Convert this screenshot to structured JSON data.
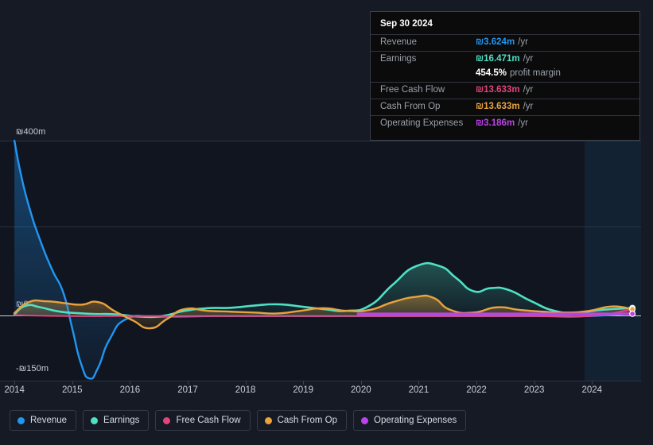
{
  "tooltip": {
    "date": "Sep 30 2024",
    "rows": [
      {
        "label": "Revenue",
        "value": "₪3.624m",
        "unit": "/yr",
        "color": "#2196f3"
      },
      {
        "label": "Earnings",
        "value": "₪16.471m",
        "unit": "/yr",
        "color": "#4fe0c4"
      },
      {
        "label": "Free Cash Flow",
        "value": "₪13.633m",
        "unit": "/yr",
        "color": "#e0457b"
      },
      {
        "label": "Cash From Op",
        "value": "₪13.633m",
        "unit": "/yr",
        "color": "#e8a33d"
      },
      {
        "label": "Operating Expenses",
        "value": "₪3.186m",
        "unit": "/yr",
        "color": "#bb44e8"
      }
    ],
    "profit_margin_value": "454.5%",
    "profit_margin_label": "profit margin"
  },
  "legend": {
    "items": [
      {
        "label": "Revenue",
        "color": "#2196f3"
      },
      {
        "label": "Earnings",
        "color": "#4fe0c4"
      },
      {
        "label": "Free Cash Flow",
        "color": "#e0457b"
      },
      {
        "label": "Cash From Op",
        "color": "#e8a33d"
      },
      {
        "label": "Operating Expenses",
        "color": "#bb44e8"
      }
    ]
  },
  "axis": {
    "y_top_label": "₪400m",
    "y_zero_label": "₪0",
    "y_bottom_label": "-₪150m",
    "x_labels": [
      "2014",
      "2015",
      "2016",
      "2017",
      "2018",
      "2019",
      "2020",
      "2021",
      "2022",
      "2023",
      "2024"
    ]
  },
  "chart_data": {
    "type": "area",
    "title": "",
    "xlabel": "",
    "ylabel": "₪",
    "ylim": [
      -150,
      400
    ],
    "y_ticks": [
      400,
      200,
      0,
      -150
    ],
    "y_tick_labels": [
      "₪400m",
      "",
      "₪0",
      "-₪150m"
    ],
    "grid": true,
    "legend_position": "bottom",
    "x_range": [
      2013.8,
      2024.9
    ],
    "x_tick_labels": [
      "2014",
      "2015",
      "2016",
      "2017",
      "2018",
      "2019",
      "2020",
      "2021",
      "2022",
      "2023",
      "2024"
    ],
    "forecast_start": 2023.9,
    "units": "ILS millions per year",
    "series": [
      {
        "name": "Revenue",
        "color": "#2196f3",
        "x": [
          2014.05,
          2014.15,
          2014.3,
          2014.5,
          2014.7,
          2014.9,
          2015.05,
          2015.2,
          2015.35,
          2015.5,
          2015.7,
          2016.0,
          2016.5,
          2017.0,
          2017.5,
          2018.0,
          2018.5,
          2019.0,
          2019.5,
          2020.0,
          2020.5,
          2021.0,
          2021.5,
          2022.0,
          2022.5,
          2023.0,
          2023.5,
          2024.0,
          2024.75
        ],
        "values": [
          400,
          330,
          250,
          170,
          105,
          50,
          -30,
          -110,
          -145,
          -120,
          -55,
          -8,
          -4,
          -3,
          -2,
          -2,
          -2,
          -2,
          -2,
          -2,
          -2,
          -2,
          -2,
          -2,
          -2,
          -2,
          -2,
          -2,
          3.624
        ]
      },
      {
        "name": "Earnings",
        "color": "#4fe0c4",
        "x": [
          2014.05,
          2014.25,
          2014.5,
          2014.8,
          2015.1,
          2015.4,
          2015.8,
          2016.2,
          2016.6,
          2017.0,
          2017.4,
          2017.8,
          2018.2,
          2018.6,
          2019.0,
          2019.4,
          2019.8,
          2020.2,
          2020.6,
          2021.0,
          2021.4,
          2021.7,
          2022.0,
          2022.3,
          2022.6,
          2023.0,
          2023.4,
          2023.8,
          2024.2,
          2024.75
        ],
        "values": [
          2,
          22,
          18,
          9,
          5,
          3,
          2,
          -3,
          -2,
          10,
          16,
          17,
          22,
          25,
          20,
          14,
          10,
          22,
          70,
          112,
          113,
          85,
          55,
          62,
          58,
          32,
          10,
          6,
          12,
          16.471
        ]
      },
      {
        "name": "Free Cash Flow",
        "color": "#e0457b",
        "x": [
          2014.05,
          2015.0,
          2016.0,
          2017.0,
          2018.0,
          2019.0,
          2020.0,
          2021.0,
          2022.0,
          2023.0,
          2024.0,
          2024.75
        ],
        "values": [
          0,
          -2,
          -2,
          -2,
          -2,
          -2,
          -2,
          -2,
          -2,
          -2,
          -2,
          13.633
        ]
      },
      {
        "name": "Cash From Op",
        "color": "#e8a33d",
        "x": [
          2014.05,
          2014.3,
          2014.6,
          2014.9,
          2015.2,
          2015.5,
          2015.8,
          2016.1,
          2016.4,
          2016.7,
          2017.0,
          2017.4,
          2017.8,
          2018.2,
          2018.6,
          2019.0,
          2019.4,
          2019.8,
          2020.2,
          2020.6,
          2021.0,
          2021.3,
          2021.6,
          2022.0,
          2022.4,
          2022.8,
          2023.2,
          2023.6,
          2024.0,
          2024.4,
          2024.75
        ],
        "values": [
          5,
          30,
          32,
          28,
          24,
          30,
          8,
          -12,
          -30,
          -8,
          14,
          10,
          8,
          6,
          4,
          10,
          16,
          10,
          12,
          30,
          42,
          40,
          12,
          6,
          18,
          12,
          8,
          6,
          10,
          20,
          13.633
        ]
      },
      {
        "name": "Operating Expenses",
        "color": "#bb44e8",
        "x": [
          2020.0,
          2021.0,
          2022.0,
          2023.0,
          2024.0,
          2024.75
        ],
        "values": [
          3,
          3,
          3,
          3,
          3,
          3.186
        ]
      }
    ]
  }
}
